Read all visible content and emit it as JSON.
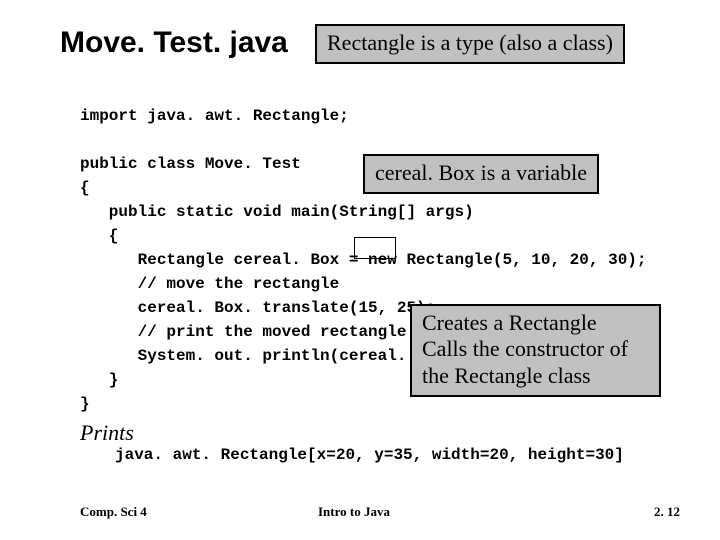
{
  "title": "Move. Test. java",
  "callouts": {
    "type": "Rectangle is a type (also a class)",
    "variable": "cereal. Box is a variable",
    "creates_line1": "Creates a Rectangle",
    "creates_line2": "Calls the constructor of",
    "creates_line3": "the Rectangle class"
  },
  "code": "import java. awt. Rectangle;\n\npublic class Move. Test\n{\n   public static void main(String[] args)\n   {\n      Rectangle cereal. Box = new Rectangle(5, 10, 20, 30);\n      // move the rectangle\n      cereal. Box. translate(15, 25);\n      // print the moved rectangle\n      System. out. println(cereal. Box);\n   }\n}",
  "prints_label": "Prints",
  "prints_output": "java. awt. Rectangle[x=20, y=35, width=20, height=30]",
  "footer": {
    "left": "Comp. Sci 4",
    "center": "Intro to Java",
    "right": "2. 12"
  }
}
